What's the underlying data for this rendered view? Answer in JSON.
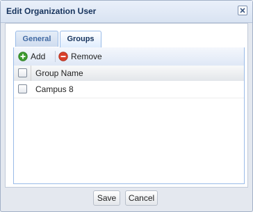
{
  "dialog": {
    "title": "Edit Organization User",
    "close_icon": "close-icon"
  },
  "tabs": [
    {
      "label": "General",
      "active": false
    },
    {
      "label": "Groups",
      "active": true
    }
  ],
  "toolbar": {
    "add_label": "Add",
    "add_icon": "plus-circle-icon",
    "remove_label": "Remove",
    "remove_icon": "minus-circle-icon",
    "add_color": "#3d9b2f",
    "remove_color": "#d9402b"
  },
  "grid": {
    "columns": [
      "Group Name"
    ],
    "rows": [
      {
        "name": "Campus 8",
        "checked": false
      }
    ]
  },
  "footer": {
    "save_label": "Save",
    "cancel_label": "Cancel"
  }
}
